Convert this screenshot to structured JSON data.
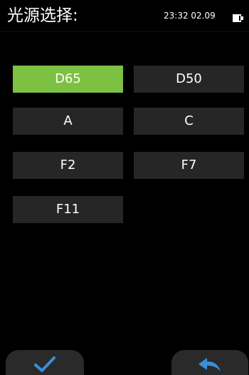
{
  "header": {
    "title": "光源选择:",
    "status_time": "23:32 02.09",
    "battery_icon": "battery-icon"
  },
  "illuminants": {
    "selected": "D65",
    "buttons": [
      {
        "label": "D65"
      },
      {
        "label": "D50"
      },
      {
        "label": "A"
      },
      {
        "label": "C"
      },
      {
        "label": "F2"
      },
      {
        "label": "F7"
      },
      {
        "label": "F11"
      }
    ]
  },
  "footer": {
    "confirm_icon": "checkmark-icon",
    "back_icon": "back-arrow-icon"
  },
  "colors": {
    "background": "#000000",
    "button": "#262626",
    "selected": "#7cc142",
    "accent_blue": "#3a8fd6"
  }
}
